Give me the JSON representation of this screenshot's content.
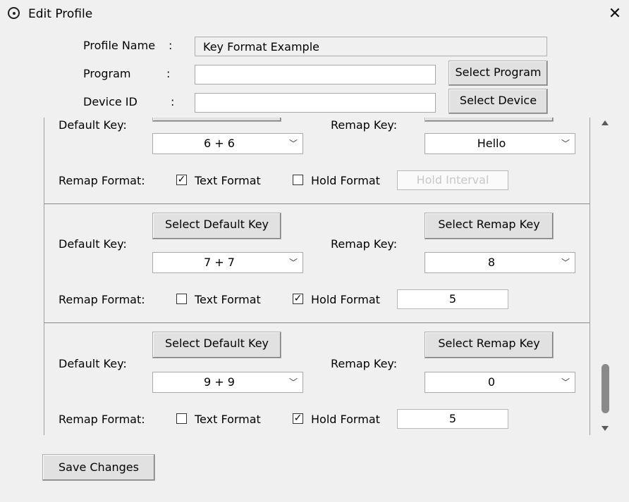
{
  "window": {
    "title": "Edit Profile",
    "close_glyph": "✕"
  },
  "header": {
    "profile_name_label": "Profile Name",
    "profile_name_sep": ":",
    "profile_name_value": "Key Format Example",
    "program_label": "Program",
    "program_sep": ":",
    "program_value": "",
    "device_label": "Device ID",
    "device_sep": ":",
    "device_value": "",
    "select_program": "Select Program",
    "select_device": "Select Device"
  },
  "mappings": [
    {
      "default_key_label": "Default Key:",
      "remap_key_label": "Remap Key:",
      "default_value": "6 + 6",
      "remap_value": "Hello",
      "remap_format_label": "Remap Format:",
      "text_format_label": "Text Format",
      "text_format_checked": "✓",
      "hold_format_label": "Hold Format",
      "hold_format_checked": "",
      "hold_interval": "Hold Interval"
    },
    {
      "select_default": "Select Default Key",
      "select_remap": "Select Remap Key",
      "default_key_label": "Default Key:",
      "remap_key_label": "Remap Key:",
      "default_value": "7 + 7",
      "remap_value": "8",
      "remap_format_label": "Remap Format:",
      "text_format_label": "Text Format",
      "text_format_checked": "",
      "hold_format_label": "Hold Format",
      "hold_format_checked": "✓",
      "hold_interval": "5"
    },
    {
      "select_default": "Select Default Key",
      "select_remap": "Select Remap Key",
      "default_key_label": "Default Key:",
      "remap_key_label": "Remap Key:",
      "default_value": "9 + 9",
      "remap_value": "0",
      "remap_format_label": "Remap Format:",
      "text_format_label": "Text Format",
      "text_format_checked": "",
      "hold_format_label": "Hold Format",
      "hold_format_checked": "✓",
      "hold_interval": "5"
    }
  ],
  "footer": {
    "save_changes": "Save Changes"
  },
  "icons": {
    "combo_chevron": "﹀",
    "app_icon": "app-icon",
    "scroll_up": "triangle-up-icon",
    "scroll_down": "triangle-down-icon"
  }
}
